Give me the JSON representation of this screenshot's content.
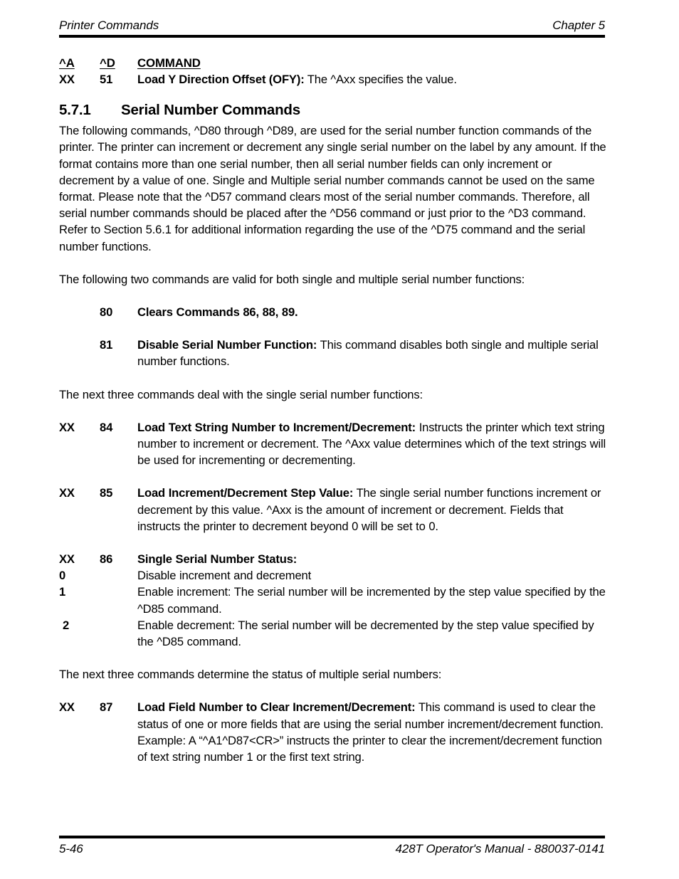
{
  "header": {
    "left": "Printer Commands",
    "right": "Chapter 5"
  },
  "footer": {
    "left": "5-46",
    "right": "428T Operator's Manual - 880037-0141"
  },
  "command_table": {
    "headers": {
      "col_a": "^A",
      "col_d": "^D",
      "col_command": "COMMAND"
    },
    "rows": [
      {
        "col_a": "XX",
        "col_d": "51",
        "title": "Load Y Direction Offset (OFY):",
        "description": " The ^Axx specifies the value."
      }
    ]
  },
  "section": {
    "number": "5.7.1",
    "title": "Serial Number Commands",
    "intro_paragraph": "The following commands, ^D80 through ^D89, are used for the serial number function commands of the printer.  The printer can increment or decrement any single serial number on the label by any amount.  If the format contains more than one serial number, then all serial number fields can only increment or decrement by a value of one.  Single and Multiple serial number commands cannot be used on the same format.  Please note that the ^D57 command clears most of the serial number commands.  Therefore, all serial number commands should be placed after the ^D56 command or just prior to the ^D3 command.  Refer to Section 5.6.1 for additional information regarding the use of the ^D75 command and the serial number functions."
  },
  "both_intro": "The following two commands are valid for both single and multiple serial number functions:",
  "both_commands": [
    {
      "num": "80",
      "title": "Clears Commands 86, 88, 89.",
      "description": ""
    },
    {
      "num": "81",
      "title": "Disable Serial Number Function:",
      "description": " This command disables both single and multiple serial number functions."
    }
  ],
  "single_intro": "The next three commands deal with the single serial number functions:",
  "single_commands": [
    {
      "col_a": "XX",
      "col_d": "84",
      "title": "Load Text String Number to Increment/Decrement:",
      "description": " Instructs the printer which text string number to increment or decrement.  The ^Axx value determines which of the text strings will be used for incrementing or decrementing."
    },
    {
      "col_a": "XX",
      "col_d": "85",
      "title": "Load Increment/Decrement Step Value:",
      "description": " The single serial number functions increment or decrement by this value.  ^Axx is the amount of increment or decrement. Fields that instructs the printer to decrement beyond 0 will be set to 0."
    }
  ],
  "status_command": {
    "col_a": "XX",
    "col_d": "86",
    "title": "Single Serial Number Status:",
    "options": [
      {
        "key": "0",
        "text": "Disable increment and decrement"
      },
      {
        "key": "1",
        "text": "Enable increment:  The serial number will be incremented by the step value specified by the ^D85 command."
      },
      {
        "key": "2",
        "text": "Enable decrement:  The serial number will be decremented by the step value specified by the ^D85 command."
      }
    ]
  },
  "multiple_intro": "The next three commands determine the status of multiple serial numbers:",
  "multiple_commands": [
    {
      "col_a": "XX",
      "col_d": "87",
      "title": "Load Field Number to Clear Increment/Decrement:",
      "description": " This command is used to clear the status of one or more fields that are using the serial number increment/decrement function.  Example: A “^A1^D87<CR>” instructs the printer to clear the increment/decrement function of text string number 1 or the first text string."
    }
  ]
}
